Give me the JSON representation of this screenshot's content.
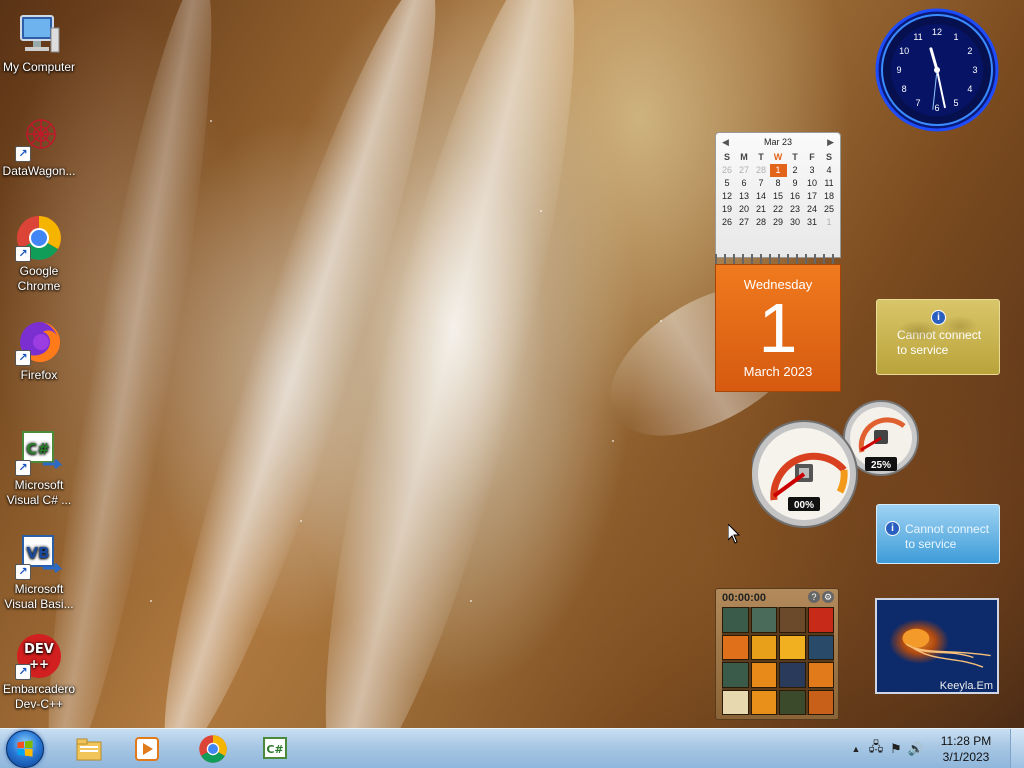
{
  "desktop": {
    "icons": [
      {
        "label_1": "My Computer",
        "label_2": "",
        "icon": "computer-icon"
      },
      {
        "label_1": "DataWagon...",
        "label_2": "",
        "icon": "datawagon-icon"
      },
      {
        "label_1": "Google",
        "label_2": "Chrome",
        "icon": "chrome-icon"
      },
      {
        "label_1": "Firefox",
        "label_2": "",
        "icon": "firefox-icon"
      },
      {
        "label_1": "Microsoft",
        "label_2": "Visual C# ...",
        "icon": "visual-csharp-icon"
      },
      {
        "label_1": "Microsoft",
        "label_2": "Visual Basi...",
        "icon": "visual-basic-icon"
      },
      {
        "label_1": "Embarcadero",
        "label_2": "Dev-C++",
        "icon": "dev-cpp-icon"
      }
    ]
  },
  "calendar": {
    "month_label": "Mar 23",
    "weekdays": [
      "S",
      "M",
      "T",
      "W",
      "T",
      "F",
      "S"
    ],
    "rows": [
      [
        "26",
        "27",
        "28",
        "1",
        "2",
        "3",
        "4"
      ],
      [
        "5",
        "6",
        "7",
        "8",
        "9",
        "10",
        "11"
      ],
      [
        "12",
        "13",
        "14",
        "15",
        "16",
        "17",
        "18"
      ],
      [
        "19",
        "20",
        "21",
        "22",
        "23",
        "24",
        "25"
      ],
      [
        "26",
        "27",
        "28",
        "29",
        "30",
        "31",
        "1"
      ]
    ],
    "weekday_name": "Wednesday",
    "day": "1",
    "month_year": "March 2023"
  },
  "clock": {
    "numerals": [
      "12",
      "1",
      "2",
      "3",
      "4",
      "5",
      "6",
      "7",
      "8",
      "9",
      "10",
      "11"
    ],
    "hour": 11,
    "minute": 28,
    "second": 31
  },
  "weather_gadget": {
    "line_1": "Cannot connect",
    "line_2": "to service",
    "icon": "info-icon"
  },
  "feed_gadget": {
    "line_1": "Cannot connect",
    "line_2": "to service",
    "icon": "info-icon"
  },
  "cpu_meter": {
    "cpu_label": "00%",
    "memory_label": "25%",
    "cpu_value": 0,
    "memory_value": 25
  },
  "puzzle": {
    "timer": "00:00:00",
    "help_icon": "?",
    "options_icon": "⚙"
  },
  "slideshow": {
    "caption": "Keeyla.Em"
  },
  "taskbar": {
    "pinned": [
      {
        "name": "file-explorer-icon"
      },
      {
        "name": "media-player-icon"
      },
      {
        "name": "chrome-icon"
      },
      {
        "name": "visual-csharp-icon"
      }
    ],
    "tray": {
      "show_hidden": "▲",
      "time": "11:28 PM",
      "date": "3/1/2023"
    }
  }
}
